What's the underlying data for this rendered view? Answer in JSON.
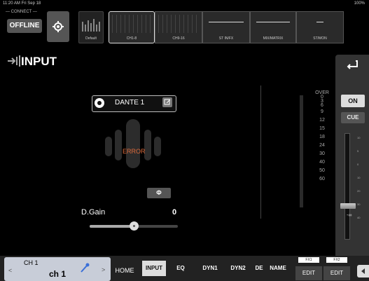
{
  "status": {
    "time": "11:20 AM  Fri Sep 18",
    "battery": "100%"
  },
  "connect": {
    "label": "CONNECT",
    "offline": "OFFLINE"
  },
  "scene": {
    "label": "Default"
  },
  "meter_groups": [
    {
      "label": "CH1-8"
    },
    {
      "label": "CH9-16"
    },
    {
      "label": "ST IN/FX"
    },
    {
      "label": "MIX/MATRIX"
    },
    {
      "label": "ST/MON"
    }
  ],
  "page": {
    "title": "INPUT"
  },
  "dante": {
    "label": "DANTE 1"
  },
  "status_error": "ERROR",
  "phase": {
    "label": "Φ"
  },
  "dgain": {
    "label": "D.Gain",
    "value": "0",
    "level": 0.5
  },
  "meter_scale": [
    "OVER",
    "0",
    "3",
    "6",
    "9",
    "12",
    "15",
    "18",
    "24",
    "30",
    "40",
    "50",
    "60"
  ],
  "right_panel": {
    "on": "ON",
    "cue": "CUE",
    "fader_value": "-∞",
    "fader_ticks": [
      "10",
      "5",
      "0",
      "10",
      "20",
      "30",
      "40",
      "50"
    ]
  },
  "bottom": {
    "ch_num": "CH 1",
    "ch_name": "ch 1",
    "home": "HOME",
    "tabs": [
      "INPUT",
      "EQ",
      "DYN1",
      "DYN2",
      "DE",
      "NAME"
    ],
    "fx1": "FX1",
    "fx2": "FX2",
    "edit": "EDIT"
  },
  "colors": {
    "error": "#e06c3c",
    "background": "#000000",
    "panel": "#333333"
  }
}
